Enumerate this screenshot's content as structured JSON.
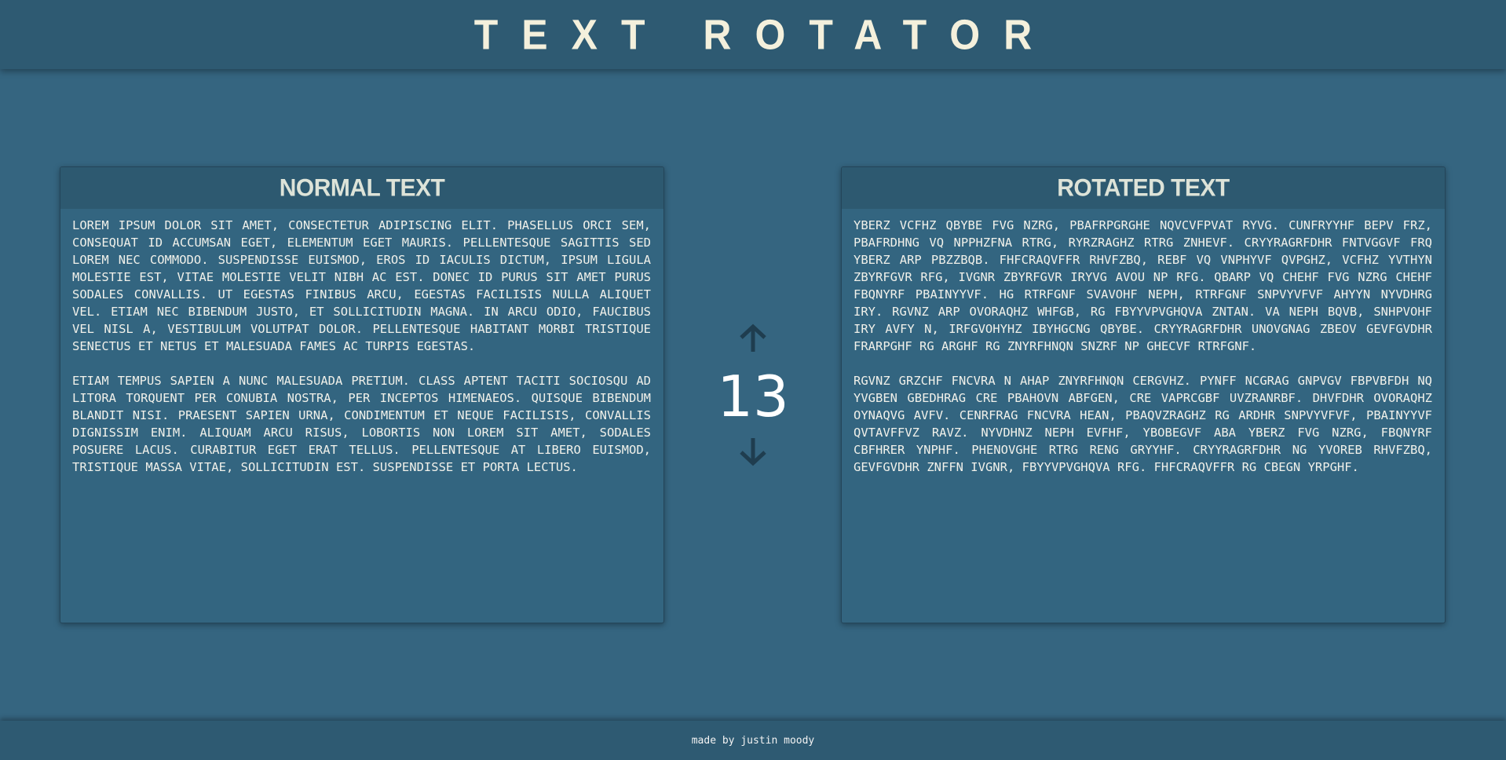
{
  "header": {
    "title": "TEXT ROTATOR"
  },
  "normal": {
    "title": "NORMAL TEXT",
    "paragraphs": [
      "LOREM IPSUM DOLOR SIT AMET, CONSECTETUR ADIPISCING ELIT. PHASELLUS ORCI SEM, CONSEQUAT ID ACCUMSAN EGET, ELEMENTUM EGET MAURIS. PELLENTESQUE SAGITTIS SED LOREM NEC COMMODO. SUSPENDISSE EUISMOD, EROS ID IACULIS DICTUM, IPSUM LIGULA MOLESTIE EST, VITAE MOLESTIE VELIT NIBH AC EST. DONEC ID PURUS SIT AMET PURUS SODALES CONVALLIS. UT EGESTAS FINIBUS ARCU, EGESTAS FACILISIS NULLA ALIQUET VEL. ETIAM NEC BIBENDUM JUSTO, ET SOLLICITUDIN MAGNA. IN ARCU ODIO, FAUCIBUS VEL NISL A, VESTIBULUM VOLUTPAT DOLOR. PELLENTESQUE HABITANT MORBI TRISTIQUE SENECTUS ET NETUS ET MALESUADA FAMES AC TURPIS EGESTAS.",
      "ETIAM TEMPUS SAPIEN A NUNC MALESUADA PRETIUM. CLASS APTENT TACITI SOCIOSQU AD LITORA TORQUENT PER CONUBIA NOSTRA, PER INCEPTOS HIMENAEOS. QUISQUE BIBENDUM BLANDIT NISI. PRAESENT SAPIEN URNA, CONDIMENTUM ET NEQUE FACILISIS, CONVALLIS DIGNISSIM ENIM. ALIQUAM ARCU RISUS, LOBORTIS NON LOREM SIT AMET, SODALES POSUERE LACUS. CURABITUR EGET ERAT TELLUS. PELLENTESQUE AT LIBERO EUISMOD, TRISTIQUE MASSA VITAE, SOLLICITUDIN EST. SUSPENDISSE ET PORTA LECTUS."
    ]
  },
  "rotator": {
    "value": "13",
    "up_icon": "arrow-up-icon",
    "down_icon": "arrow-down-icon"
  },
  "rotated": {
    "title": "ROTATED TEXT",
    "paragraphs": [
      "YBERZ VCFHZ QBYBE FVG NZRG, PBAFRPGRGHE NQVCVFPVAT RYVG. CUNFRYYHF BEPV FRZ, PBAFRDHNG VQ NPPHZFNA RTRG, RYRZRAGHZ RTRG ZNHEVF. CRYYRAGRFDHR FNTVGGVF FRQ YBERZ ARP PBZZBQB. FHFCRAQVFFR RHVFZBQ, REBF VQ VNPHYVF QVPGHZ, VCFHZ YVTHYN ZBYRFGVR RFG, IVGNR ZBYRFGVR IRYVG AVOU NP RFG. QBARP VQ CHEHF FVG NZRG CHEHF FBQNYRF PBAINYYVF. HG RTRFGNF SVAVOHF NEPH, RTRFGNF SNPVYVFVF AHYYN NYVDHRG IRY. RGVNZ ARP OVORAQHZ WHFGB, RG FBYYVPVGHQVA ZNTAN. VA NEPH BQVB, SNHPVOHF IRY AVFY N, IRFGVOHYHZ IBYHGCNG QBYBE. CRYYRAGRFDHR UNOVGNAG ZBEOV GEVFGVDHR FRARPGHF RG ARGHF RG ZNYRFHNQN SNZRF NP GHECVF RTRFGNF.",
      "RGVNZ GRZCHF FNCVRA N AHAP ZNYRFHNQN CERGVHZ. PYNFF NCGRAG GNPVGV FBPVBFDH NQ YVGBEN GBEDHRAG CRE PBAHOVN ABFGEN, CRE VAPRCGBF UVZRANRBF. DHVFDHR OVORAQHZ OYNAQVG AVFV. CENRFRAG FNCVRA HEAN, PBAQVZRAGHZ RG ARDHR SNPVYVFVF, PBAINYYVF QVTAVFFVZ RAVZ. NYVDHNZ NEPH EVFHF, YBOBEGVF ABA YBERZ FVG NZRG, FBQNYRF CBFHRER YNPHF. PHENOVGHE RTRG RENG GRYYHF. CRYYRAGRFDHR NG YVOREB RHVFZBQ, GEVFGVDHR ZNFFN IVGNR, FBYYVPVGHQVA RFG. FHFCRAQVFFR RG CBEGN YRPGHF."
    ]
  },
  "footer": {
    "text": "made by justin moody"
  },
  "colors": {
    "background": "#356580",
    "header_bg": "#2e5a72",
    "panel_header_bg": "#2d5970",
    "title_text": "#f4f0dc",
    "arrow": "#1f3d4f"
  }
}
